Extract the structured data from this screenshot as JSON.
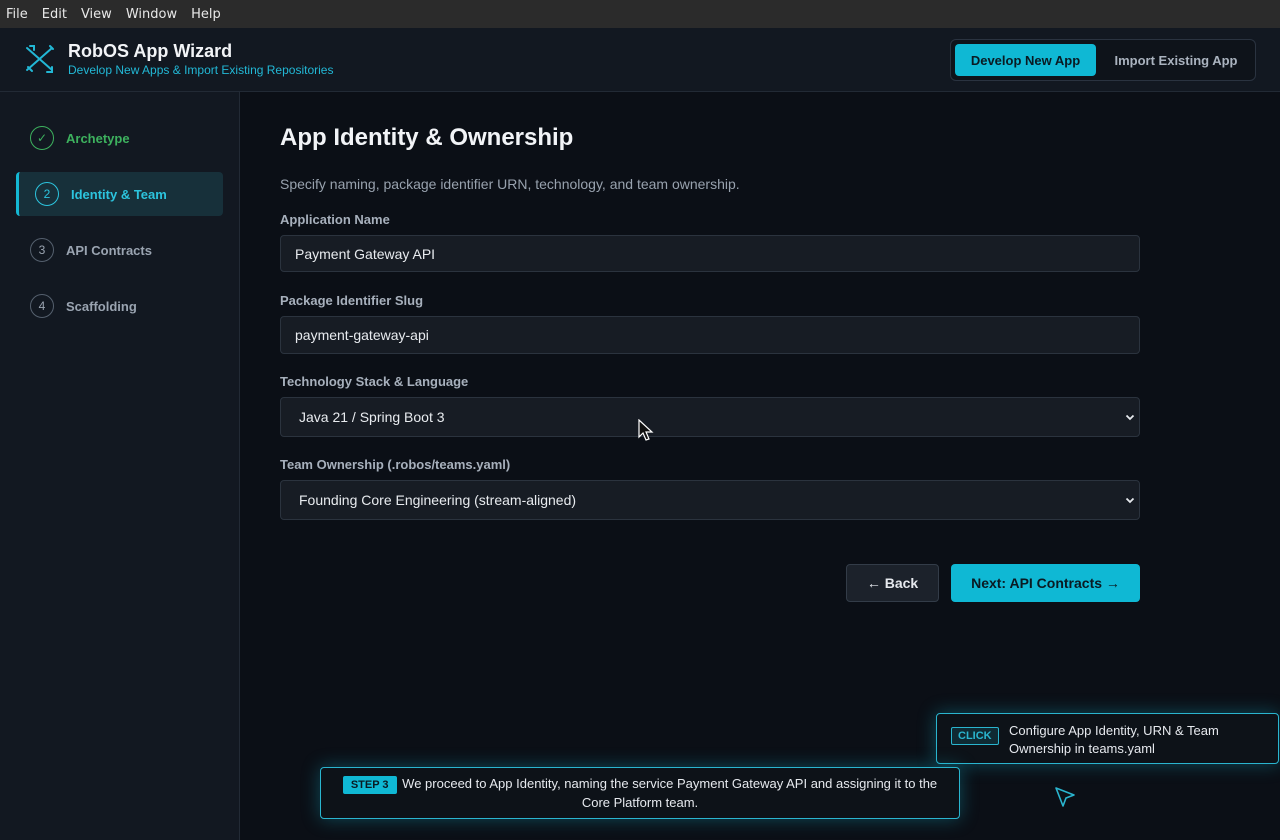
{
  "menubar": [
    "File",
    "Edit",
    "View",
    "Window",
    "Help"
  ],
  "header": {
    "title": "RobOS App Wizard",
    "subtitle": "Develop New Apps & Import Existing Repositories",
    "mode_develop": "Develop New App",
    "mode_import": "Import Existing App"
  },
  "steps": [
    {
      "num": "✓",
      "label": "Archetype",
      "state": "done"
    },
    {
      "num": "2",
      "label": "Identity & Team",
      "state": "current"
    },
    {
      "num": "3",
      "label": "API Contracts",
      "state": "pending"
    },
    {
      "num": "4",
      "label": "Scaffolding",
      "state": "pending"
    }
  ],
  "main": {
    "title": "App Identity & Ownership",
    "description": "Specify naming, package identifier URN, technology, and team ownership.",
    "app_name_label": "Application Name",
    "app_name_value": "Payment Gateway API",
    "slug_label": "Package Identifier Slug",
    "slug_value": "payment-gateway-api",
    "stack_label": "Technology Stack & Language",
    "stack_value": "Java 21 / Spring Boot 3",
    "team_label": "Team Ownership (.robos/teams.yaml)",
    "team_value": "Founding Core Engineering (stream-aligned)",
    "back_label": "← Back",
    "next_label": "Next: API Contracts →"
  },
  "tooltips": {
    "click_badge": "CLICK",
    "click_text": "Configure App Identity, URN & Team Ownership in teams.yaml",
    "step_badge": "STEP 3",
    "step_text": "We proceed to App Identity, naming the service Payment Gateway API and assigning it to the Core Platform team."
  },
  "colors": {
    "accent": "#0fb8d4",
    "success": "#3db15e",
    "background": "#0b0f16"
  }
}
